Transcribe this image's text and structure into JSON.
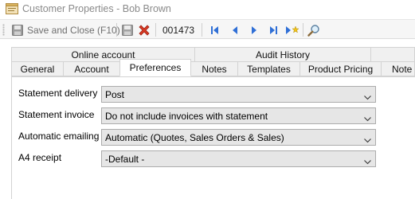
{
  "window": {
    "title": "Customer Properties - Bob Brown",
    "icon": "customer-properties-icon"
  },
  "toolbar": {
    "save_close_label": "Save and Close (F10)",
    "record_number": "001473",
    "icons": [
      "save-close-icon",
      "save-icon",
      "delete-icon",
      "first-record-icon",
      "previous-record-icon",
      "next-record-icon",
      "last-record-icon",
      "new-record-icon",
      "search-icon"
    ]
  },
  "tabs": {
    "row1": [
      {
        "label": "Online account"
      },
      {
        "label": "Audit History"
      }
    ],
    "row2": [
      {
        "label": "General"
      },
      {
        "label": "Account"
      },
      {
        "label": "Preferences",
        "active": true
      },
      {
        "label": "Notes"
      },
      {
        "label": "Templates"
      },
      {
        "label": "Product Pricing"
      },
      {
        "label": "Note L"
      }
    ]
  },
  "preferences": {
    "fields": [
      {
        "label": "Statement delivery",
        "value": "Post"
      },
      {
        "label": "Statement invoice",
        "value": "Do not include invoices with statement"
      },
      {
        "label": "Automatic emailing",
        "value": "Automatic (Quotes, Sales Orders & Sales)"
      },
      {
        "label": "A4 receipt",
        "value": "-Default -"
      }
    ]
  },
  "colors": {
    "delete_icon": "#d83a24",
    "nav_icon": "#2f6fd6",
    "combo_background": "#e6e6e6"
  }
}
